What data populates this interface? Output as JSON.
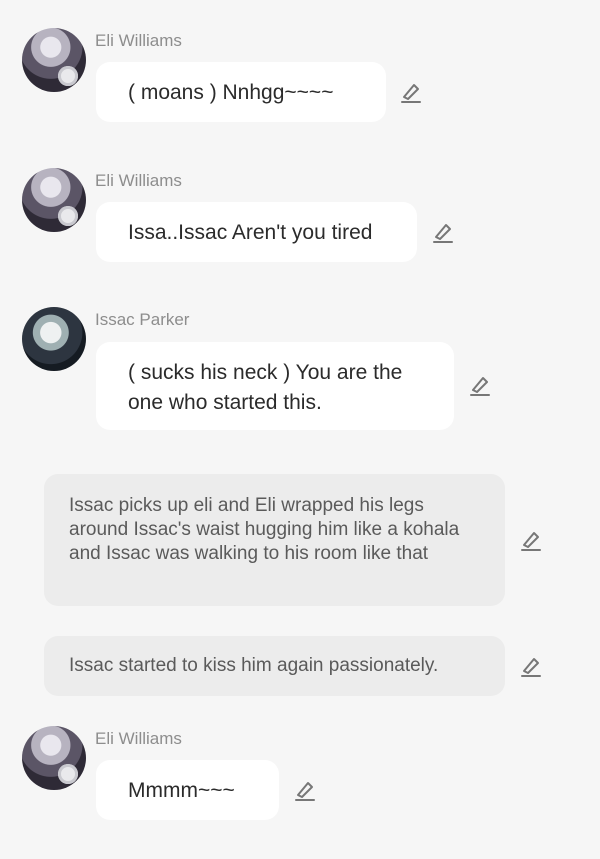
{
  "messages": [
    {
      "type": "character",
      "name": "Eli Williams",
      "avatar": "eli-avatar",
      "text": "( moans ) Nnhgg~~~~"
    },
    {
      "type": "character",
      "name": "Eli Williams",
      "avatar": "eli-avatar",
      "text": "Issa..Issac Aren't you tired"
    },
    {
      "type": "character",
      "name": "Issac Parker",
      "avatar": "issac-avatar",
      "text": "( sucks his neck ) You are the one who started this."
    },
    {
      "type": "narration",
      "text": "Issac picks up eli and Eli wrapped his legs around Issac's waist hugging him like a kohala and Issac was walking to his room like that"
    },
    {
      "type": "narration",
      "text": "Issac started to kiss him again passionately."
    },
    {
      "type": "character",
      "name": "Eli Williams",
      "avatar": "eli-avatar",
      "text": "Mmmm~~~"
    }
  ],
  "icons": {
    "edit": "pencil-icon"
  },
  "colors": {
    "background": "#f6f6f6",
    "bubble": "#ffffff",
    "narration": "#ececec",
    "name": "#8d8d8d"
  }
}
